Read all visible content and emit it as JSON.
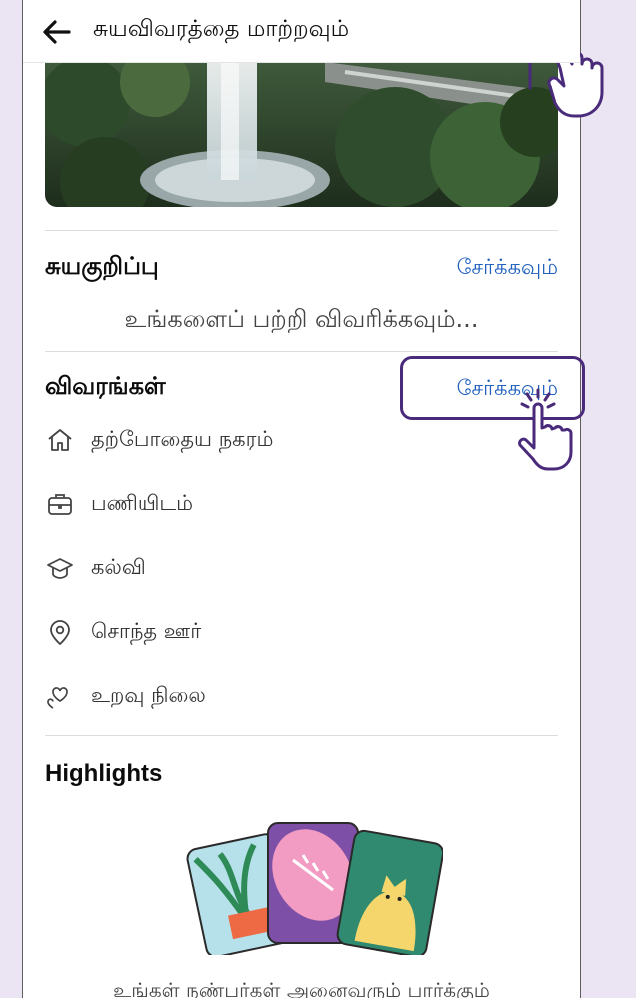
{
  "header": {
    "back_icon": "arrow-left-icon",
    "title": "சுயவிவரத்தை மாற்றவும்"
  },
  "bio": {
    "title": "சுயகுறிப்பு",
    "add_label": "சேர்க்கவும்",
    "placeholder": "உங்களைப் பற்றி விவரிக்கவும்..."
  },
  "details": {
    "title": "விவரங்கள்",
    "add_label": "சேர்க்கவும்",
    "items": [
      {
        "icon": "home-icon",
        "label": "தற்போதைய நகரம்"
      },
      {
        "icon": "briefcase-icon",
        "label": "பணியிடம்"
      },
      {
        "icon": "graduation-cap-icon",
        "label": "கல்வி"
      },
      {
        "icon": "location-pin-icon",
        "label": "சொந்த ஊர்"
      },
      {
        "icon": "hearts-icon",
        "label": "உறவு நிலை"
      }
    ]
  },
  "highlights": {
    "title": "Highlights",
    "description": "உங்கள் நண்பர்கள் அனைவரும் பார்க்கும்"
  },
  "colors": {
    "link": "#1f5fbd",
    "annotation": "#4a2a7a",
    "background": "#ebe5f3"
  }
}
